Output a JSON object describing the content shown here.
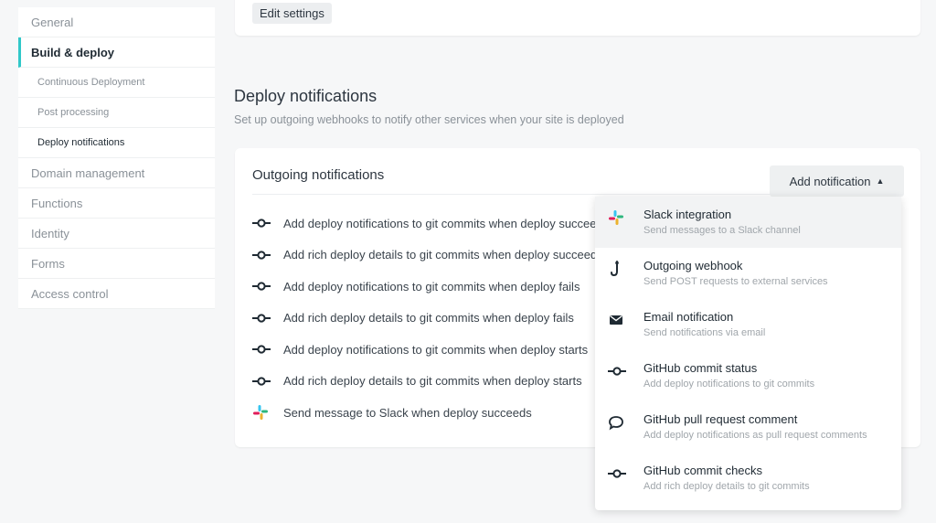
{
  "sidebar": {
    "items": [
      {
        "label": "General"
      },
      {
        "label": "Build & deploy"
      },
      {
        "label": "Continuous Deployment"
      },
      {
        "label": "Post processing"
      },
      {
        "label": "Deploy notifications"
      },
      {
        "label": "Domain management"
      },
      {
        "label": "Functions"
      },
      {
        "label": "Identity"
      },
      {
        "label": "Forms"
      },
      {
        "label": "Access control"
      }
    ]
  },
  "top_card": {
    "edit_label": "Edit settings"
  },
  "section": {
    "title": "Deploy notifications",
    "description": "Set up outgoing webhooks to notify other services when your site is deployed"
  },
  "card": {
    "title": "Outgoing notifications",
    "add_button": "Add notification",
    "notifications": [
      {
        "text": "Add deploy notifications to git commits when deploy succeeds",
        "icon": "git-commit-icon"
      },
      {
        "text": "Add rich deploy details to git commits when deploy succeeds",
        "icon": "git-commit-icon"
      },
      {
        "text": "Add deploy notifications to git commits when deploy fails",
        "icon": "git-commit-icon"
      },
      {
        "text": "Add rich deploy details to git commits when deploy fails",
        "icon": "git-commit-icon"
      },
      {
        "text": "Add deploy notifications to git commits when deploy starts",
        "icon": "git-commit-icon"
      },
      {
        "text": "Add rich deploy details to git commits when deploy starts",
        "icon": "git-commit-icon"
      },
      {
        "text": "Send message to Slack when deploy succeeds",
        "icon": "slack-icon"
      }
    ]
  },
  "dropdown": {
    "items": [
      {
        "title": "Slack integration",
        "desc": "Send messages to a Slack channel",
        "icon": "slack-icon"
      },
      {
        "title": "Outgoing webhook",
        "desc": "Send POST requests to external services",
        "icon": "webhook-icon"
      },
      {
        "title": "Email notification",
        "desc": "Send notifications via email",
        "icon": "envelope-icon"
      },
      {
        "title": "GitHub commit status",
        "desc": "Add deploy notifications to git commits",
        "icon": "git-commit-icon"
      },
      {
        "title": "GitHub pull request comment",
        "desc": "Add deploy notifications as pull request comments",
        "icon": "comment-icon"
      },
      {
        "title": "GitHub commit checks",
        "desc": "Add rich deploy details to git commits",
        "icon": "git-commit-icon"
      }
    ]
  },
  "colors": {
    "accent": "#30c8c9"
  }
}
